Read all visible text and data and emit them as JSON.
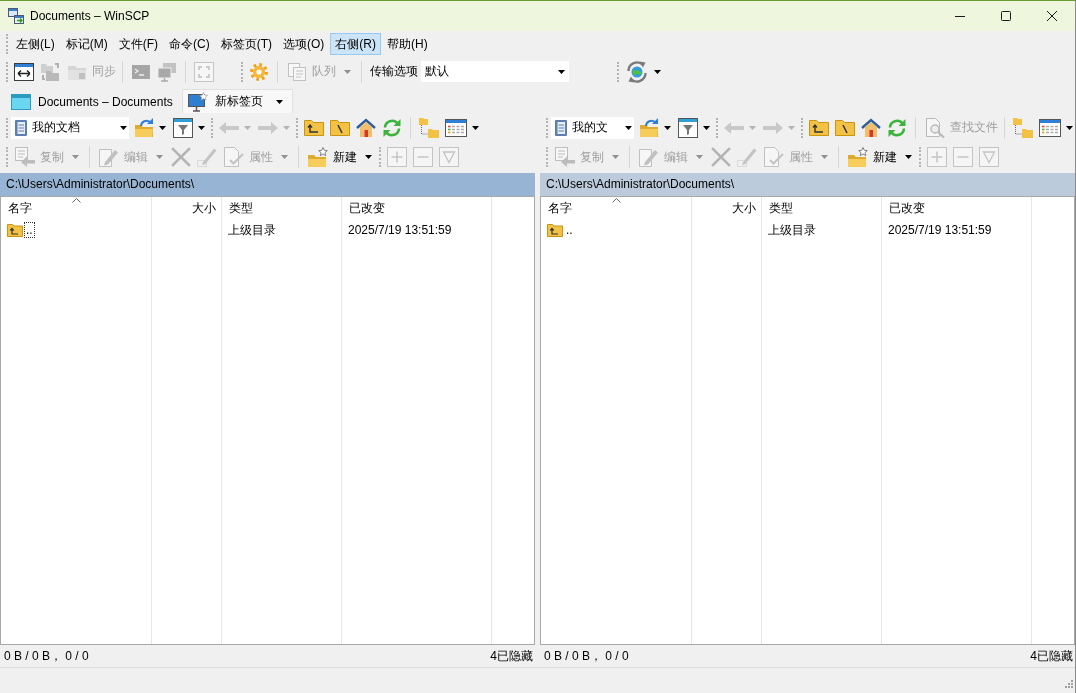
{
  "window": {
    "title": "Documents – WinSCP"
  },
  "menu": [
    {
      "label": "左侧(L)",
      "selected": false
    },
    {
      "label": "标记(M)",
      "selected": false
    },
    {
      "label": "文件(F)",
      "selected": false
    },
    {
      "label": "命令(C)",
      "selected": false
    },
    {
      "label": "标签页(T)",
      "selected": false
    },
    {
      "label": "选项(O)",
      "selected": false
    },
    {
      "label": "右侧(R)",
      "selected": true
    },
    {
      "label": "帮助(H)",
      "selected": false
    }
  ],
  "toolbar": {
    "sync": {
      "label": "同步",
      "disabled": true
    },
    "queue": {
      "label": "队列",
      "disabled": true
    },
    "transfer_settings": {
      "label": "传输选项",
      "value": "默认"
    }
  },
  "tabs": [
    {
      "label": "Documents – Documents",
      "selected": true
    },
    {
      "label": "新标签页",
      "selected": false
    }
  ],
  "panels": [
    {
      "active": true,
      "location": "我的文档",
      "buttons": [
        {
          "label": "复制",
          "disabled": true
        },
        {
          "label": "编辑",
          "disabled": true
        },
        {
          "label": "属性",
          "disabled": true
        },
        {
          "label": "新建",
          "disabled": false
        }
      ],
      "path": "C:\\Users\\Administrator\\Documents\\",
      "columns": [
        {
          "label": "名字",
          "sorted": true
        },
        {
          "label": "大小",
          "sorted": false
        },
        {
          "label": "类型",
          "sorted": false
        },
        {
          "label": "已改变",
          "sorted": false
        }
      ],
      "rows": [
        {
          "name": "..",
          "type": "上级目录",
          "modified": "2025/7/19 13:51:59",
          "focused": true
        }
      ],
      "status": {
        "selection": "0 B / 0 B， 0 / 0",
        "hidden": "4已隐藏"
      }
    },
    {
      "active": false,
      "location": "我的文",
      "find": {
        "label": "查找文件",
        "disabled": true
      },
      "buttons": [
        {
          "label": "复制",
          "disabled": true
        },
        {
          "label": "编辑",
          "disabled": true
        },
        {
          "label": "属性",
          "disabled": true
        },
        {
          "label": "新建",
          "disabled": false
        }
      ],
      "path": "C:\\Users\\Administrator\\Documents\\",
      "columns": [
        {
          "label": "名字",
          "sorted": true
        },
        {
          "label": "大小",
          "sorted": false
        },
        {
          "label": "类型",
          "sorted": false
        },
        {
          "label": "已改变",
          "sorted": false
        }
      ],
      "rows": [
        {
          "name": "..",
          "type": "上级目录",
          "modified": "2025/7/19 13:51:59",
          "focused": false
        }
      ],
      "status": {
        "selection": "0 B / 0 B， 0 / 0",
        "hidden": "4已隐藏"
      }
    }
  ]
}
